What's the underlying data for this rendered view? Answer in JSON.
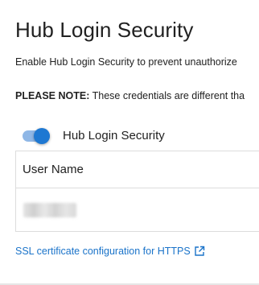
{
  "section": {
    "title": "Hub Login Security",
    "description": "Enable Hub Login Security to prevent unauthorize",
    "note_label": "PLEASE NOTE:",
    "note_text": " These credentials are different tha"
  },
  "toggle": {
    "label": "Hub Login Security",
    "checked": true,
    "accent_color": "#1e78d2"
  },
  "credentials_table": {
    "header": "User Name",
    "value": "redacted"
  },
  "link": {
    "text": "SSL certificate configuration for HTTPS",
    "icon": "external-link-icon",
    "color": "#1a73c9"
  }
}
